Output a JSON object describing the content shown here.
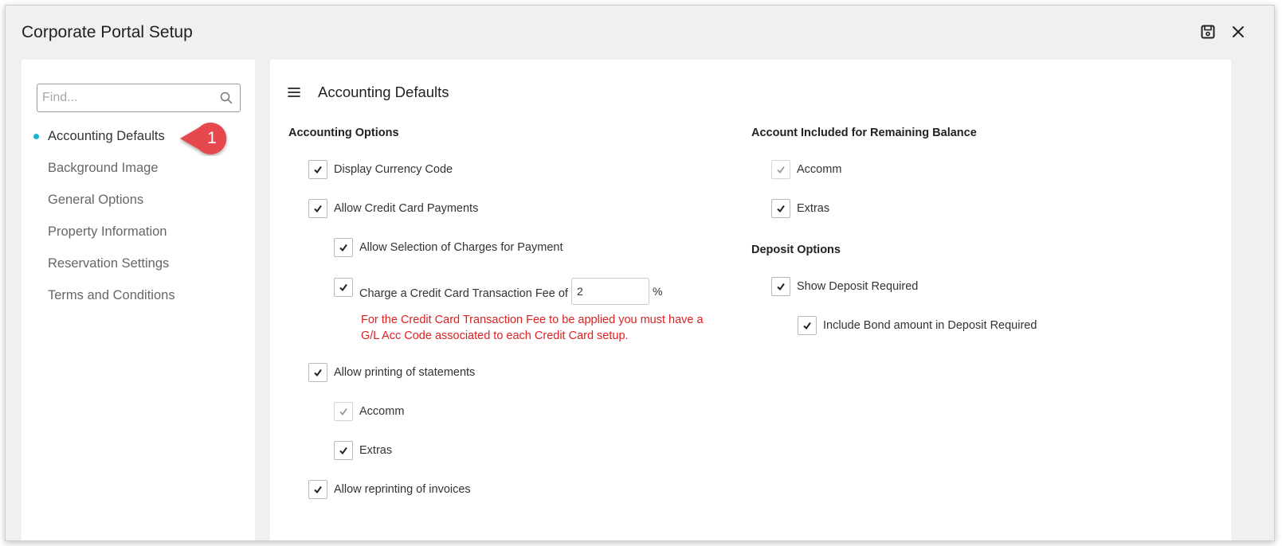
{
  "window": {
    "title": "Corporate Portal Setup"
  },
  "sidebar": {
    "search_placeholder": "Find...",
    "items": [
      {
        "label": "Accounting Defaults",
        "active": true
      },
      {
        "label": "Background Image"
      },
      {
        "label": "General Options"
      },
      {
        "label": "Property Information"
      },
      {
        "label": "Reservation Settings"
      },
      {
        "label": "Terms and Conditions"
      }
    ],
    "callout": "1"
  },
  "content": {
    "title": "Accounting Defaults",
    "accounting_options": {
      "title": "Accounting Options",
      "display_currency_code": {
        "label": "Display Currency Code",
        "checked": true
      },
      "allow_credit_card_payments": {
        "label": "Allow Credit Card Payments",
        "checked": true
      },
      "allow_selection_of_charges": {
        "label": "Allow Selection of Charges for Payment",
        "checked": true
      },
      "charge_fee": {
        "label": "Charge a Credit Card Transaction Fee of",
        "value": "2",
        "unit": "%",
        "checked": true
      },
      "fee_warning": "For the Credit Card Transaction Fee to be applied you must have a G/L Acc Code associated to each Credit Card setup.",
      "allow_printing_statements": {
        "label": "Allow printing of statements",
        "checked": true
      },
      "statements_accomm": {
        "label": "Accomm",
        "checked": true,
        "disabled": true
      },
      "statements_extras": {
        "label": "Extras",
        "checked": true
      },
      "allow_reprinting_invoices": {
        "label": "Allow reprinting of invoices",
        "checked": true
      }
    },
    "remaining_balance": {
      "title": "Account Included for Remaining Balance",
      "accomm": {
        "label": "Accomm",
        "checked": true,
        "disabled": true
      },
      "extras": {
        "label": "Extras",
        "checked": true
      }
    },
    "deposit_options": {
      "title": "Deposit Options",
      "show_deposit_required": {
        "label": "Show Deposit Required",
        "checked": true
      },
      "include_bond": {
        "label": "Include Bond amount in Deposit Required",
        "checked": true
      }
    }
  },
  "colors": {
    "accent": "#1ab3c9",
    "callout": "#e5484d",
    "warning": "#e02020"
  },
  "icons": {
    "save": "save-icon",
    "close": "close-icon",
    "search": "search-icon",
    "menu": "hamburger-icon"
  }
}
